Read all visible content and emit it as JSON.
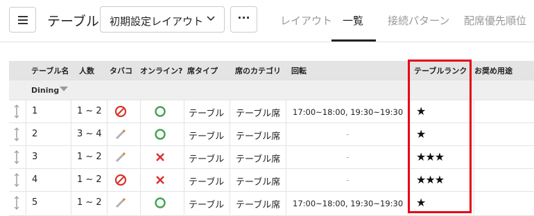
{
  "header": {
    "page_title": "テーブル",
    "layout_select": {
      "value": "初期設定レイアウト"
    },
    "more_label": "···",
    "tabs": [
      {
        "label": "レイアウト",
        "active": false
      },
      {
        "label": "一覧",
        "active": true
      },
      {
        "label": "接続パターン",
        "active": false
      },
      {
        "label": "配席優先順位",
        "active": false
      }
    ]
  },
  "table": {
    "columns": [
      "テーブル名",
      "人数",
      "タバコ",
      "オンライン?",
      "席タイプ",
      "席のカテゴリ",
      "回転",
      "テーブルランク",
      "お奨め用途"
    ],
    "group": "Dining",
    "rows": [
      {
        "name": "1",
        "people": "1 ~ 2",
        "smoking": "no-smoking-icon",
        "online": "circle-ok-icon",
        "seat_type": "テーブル",
        "category": "テーブル席",
        "rotation": "17:00~18:00, 19:30~19:30",
        "rank": "★"
      },
      {
        "name": "2",
        "people": "3 ~ 4",
        "smoking": "cigarette-icon",
        "online": "circle-ok-icon",
        "seat_type": "テーブル",
        "category": "テーブル席",
        "rotation": "-",
        "rank": "★"
      },
      {
        "name": "3",
        "people": "1 ~ 2",
        "smoking": "cigarette-icon",
        "online": "cross-icon",
        "seat_type": "テーブル",
        "category": "テーブル席",
        "rotation": "-",
        "rank": "★★★"
      },
      {
        "name": "4",
        "people": "1 ~ 2",
        "smoking": "no-smoking-icon",
        "online": "cross-icon",
        "seat_type": "テーブル",
        "category": "テーブル席",
        "rotation": "-",
        "rank": "★★★"
      },
      {
        "name": "5",
        "people": "1 ~ 2",
        "smoking": "cigarette-icon",
        "online": "circle-ok-icon",
        "seat_type": "テーブル",
        "category": "テーブル席",
        "rotation": "17:00~18:00, 19:30~19:30",
        "rank": "★"
      }
    ]
  },
  "colors": {
    "highlight": "#e60012",
    "ok_green": "#3fa34d",
    "cross_red": "#d9332b",
    "no_smoking_red": "#d9332b"
  }
}
